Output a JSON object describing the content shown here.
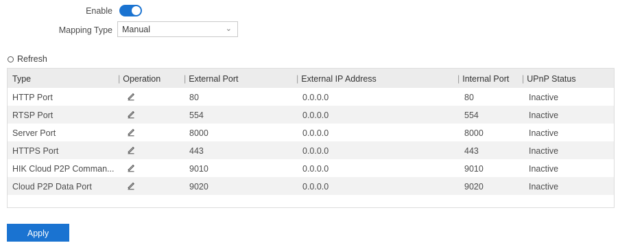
{
  "form": {
    "enable_label": "Enable",
    "enable_on": true,
    "mapping_type_label": "Mapping Type",
    "mapping_type_value": "Manual"
  },
  "toolbar": {
    "refresh_label": "Refresh"
  },
  "table": {
    "headers": [
      "Type",
      "Operation",
      "External Port",
      "External IP Address",
      "Internal Port",
      "UPnP Status"
    ],
    "rows": [
      {
        "type": "HTTP Port",
        "external_port": "80",
        "external_ip": "0.0.0.0",
        "internal_port": "80",
        "status": "Inactive"
      },
      {
        "type": "RTSP Port",
        "external_port": "554",
        "external_ip": "0.0.0.0",
        "internal_port": "554",
        "status": "Inactive"
      },
      {
        "type": "Server Port",
        "external_port": "8000",
        "external_ip": "0.0.0.0",
        "internal_port": "8000",
        "status": "Inactive"
      },
      {
        "type": "HTTPS Port",
        "external_port": "443",
        "external_ip": "0.0.0.0",
        "internal_port": "443",
        "status": "Inactive"
      },
      {
        "type": "HIK Cloud P2P Comman...",
        "external_port": "9010",
        "external_ip": "0.0.0.0",
        "internal_port": "9010",
        "status": "Inactive"
      },
      {
        "type": "Cloud P2P Data Port",
        "external_port": "9020",
        "external_ip": "0.0.0.0",
        "internal_port": "9020",
        "status": "Inactive"
      }
    ]
  },
  "footer": {
    "apply_label": "Apply"
  },
  "colors": {
    "accent": "#1a73d1",
    "header_bg": "#ececec",
    "stripe_bg": "#f2f2f2"
  }
}
